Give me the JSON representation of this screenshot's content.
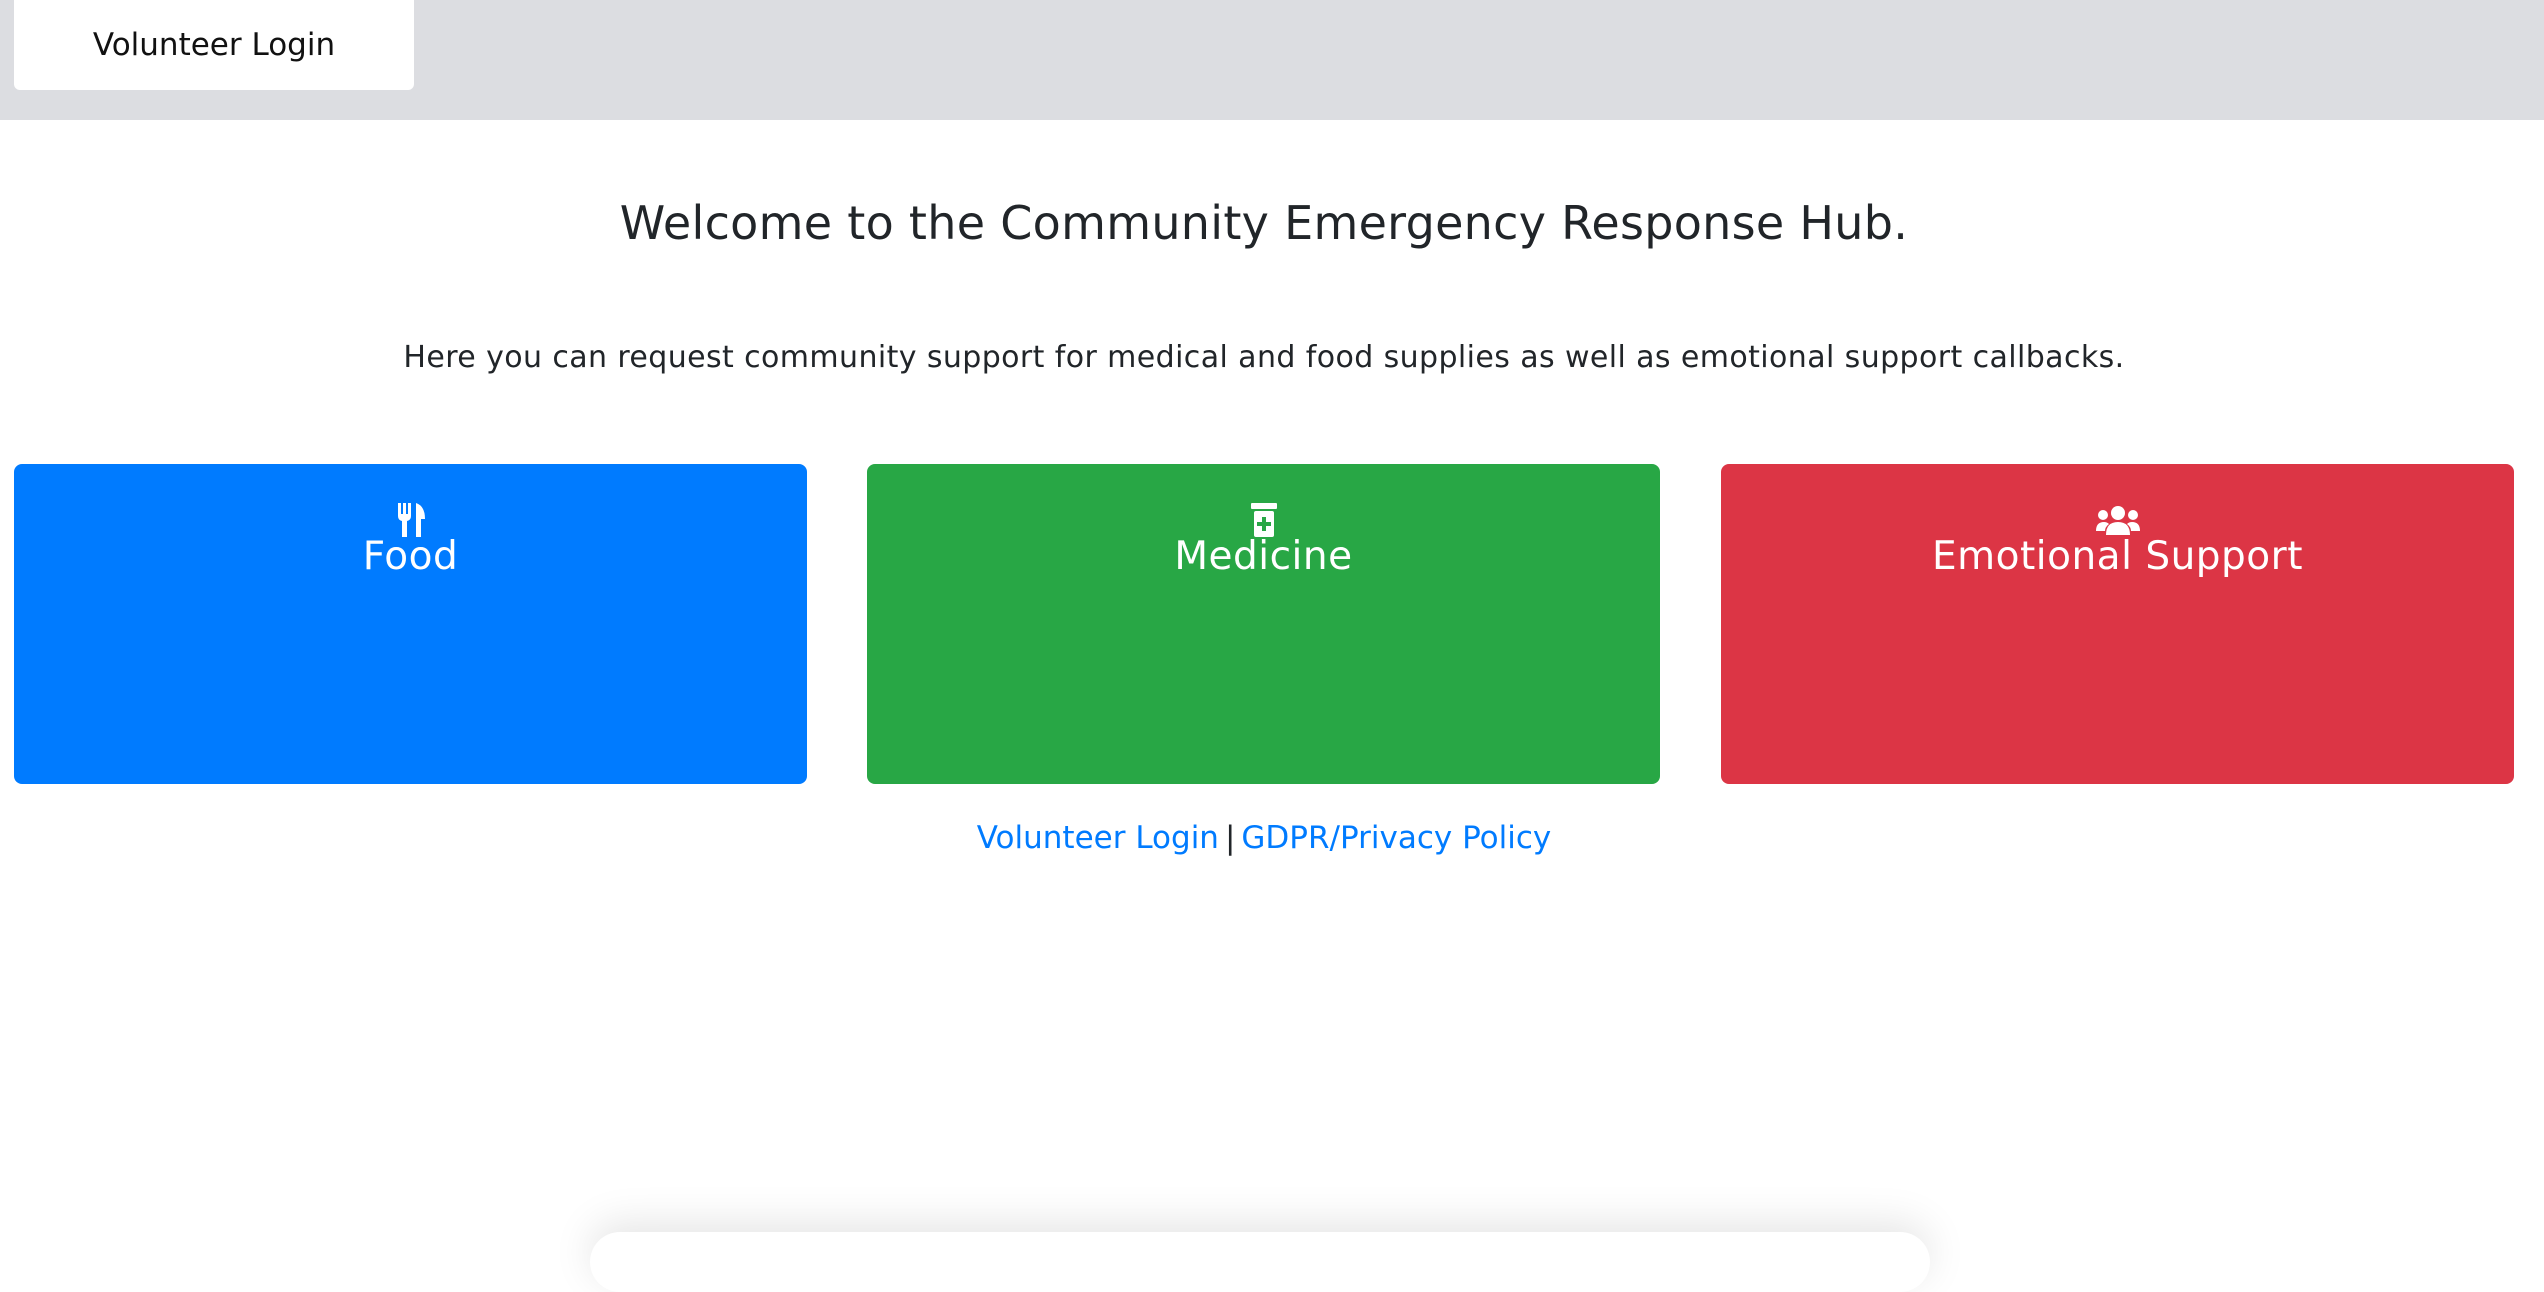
{
  "header": {
    "login_label": "Volunteer Login"
  },
  "main": {
    "title": "Welcome to the Community Emergency Response Hub.",
    "intro": "Here you can request community support for medical and food supplies as well as emotional support callbacks."
  },
  "cards": [
    {
      "label": "Food",
      "icon": "utensils-icon",
      "color": "#007bff"
    },
    {
      "label": "Medicine",
      "icon": "prescription-bottle-icon",
      "color": "#28a745"
    },
    {
      "label": "Emotional Support",
      "icon": "users-icon",
      "color": "#dc3545"
    }
  ],
  "footer": {
    "volunteer_login": "Volunteer Login",
    "separator": "|",
    "privacy": "GDPR/Privacy Policy",
    "link_color": "#007bff"
  }
}
